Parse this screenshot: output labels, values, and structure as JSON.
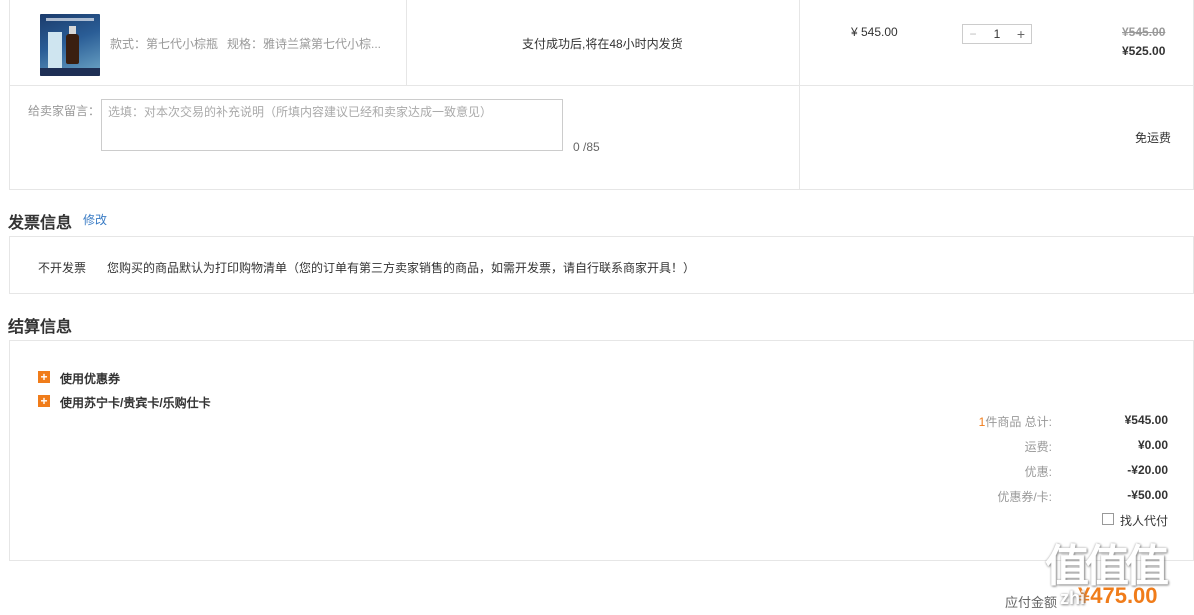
{
  "item": {
    "style_text": "款式：第七代小棕瓶",
    "spec_text": "规格：雅诗兰黛第七代小棕...",
    "ship_note": "支付成功后,将在48小时内发货",
    "unit_price": "¥ 545.00",
    "quantity": "1",
    "minus": "−",
    "plus": "+",
    "price_original": "¥545.00",
    "price_final": "¥525.00"
  },
  "message": {
    "label": "给卖家留言：",
    "placeholder": "选填：对本次交易的补充说明（所填内容建议已经和卖家达成一致意见）",
    "counter": "0 /85",
    "shipping": "免运费"
  },
  "invoice": {
    "title": "发票信息",
    "edit": "修改",
    "type": "不开发票",
    "note": "您购买的商品默认为打印购物清单（您的订单有第三方卖家销售的商品，如需开发票，请自行联系商家开具！）"
  },
  "settlement": {
    "title": "结算信息",
    "coupon": "使用优惠券",
    "cards": "使用苏宁卡/贵宾卡/乐购仕卡",
    "count": "1",
    "count_suffix": "件商品 总计:",
    "total": "¥545.00",
    "freight_label": "运费:",
    "freight": "¥0.00",
    "discount_label": "优惠:",
    "discount": "-¥20.00",
    "coupon_label": "优惠券/卡:",
    "coupon_value": "-¥50.00",
    "proxy_pay": "找人代付",
    "payable_label": "应付金额",
    "payable": "¥475.00"
  },
  "watermark": {
    "main": "值",
    "sub": "zhi"
  }
}
